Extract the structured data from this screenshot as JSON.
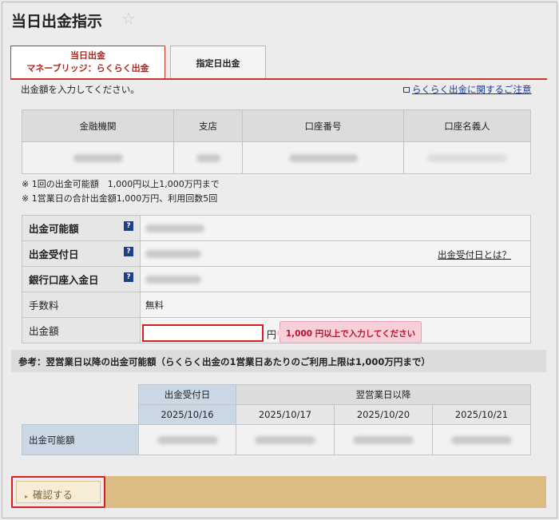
{
  "page": {
    "title": "当日出金指示",
    "instruction": "出金額を入力してください。",
    "notice_link": "らくらく出金に関するご注意"
  },
  "tabs": [
    {
      "line1": "当日出金",
      "line2": "マネーブリッジ：らくらく出金"
    },
    {
      "line1": "指定日出金"
    }
  ],
  "account_table": {
    "headers": [
      "金融機関",
      "支店",
      "口座番号",
      "口座名義人"
    ]
  },
  "notes": [
    "※ 1回の出金可能額　1,000円以上1,000万円まで",
    "※ 1営業日の合計出金額1,000万円、利用回数5回"
  ],
  "info_rows": {
    "available": "出金可能額",
    "transfer_date": "出金受付日",
    "transfer_date_link": "出金受付日とは？",
    "deposit_date": "銀行口座入金日",
    "fee_label": "手数料",
    "fee_value": "無料",
    "amount_label": "出金額",
    "amount_value": "",
    "yen": "円"
  },
  "tooltip": "1,000 円以上で入力してください",
  "reference": {
    "title": "参考：翌営業日以降の出金可能額（らくらく出金の1営業日あたりのご利用上限は1,000万円まで）",
    "col_head1": "出金受付日",
    "col_head2": "翌営業日以降",
    "dates": [
      "2025/10/16",
      "2025/10/17",
      "2025/10/20",
      "2025/10/21"
    ],
    "row_label": "出金可能額"
  },
  "actions": {
    "confirm": "確認する"
  },
  "colors": {
    "accent": "#c0392b",
    "button_bar": "#dcbc84",
    "link": "#1a3a9a"
  }
}
